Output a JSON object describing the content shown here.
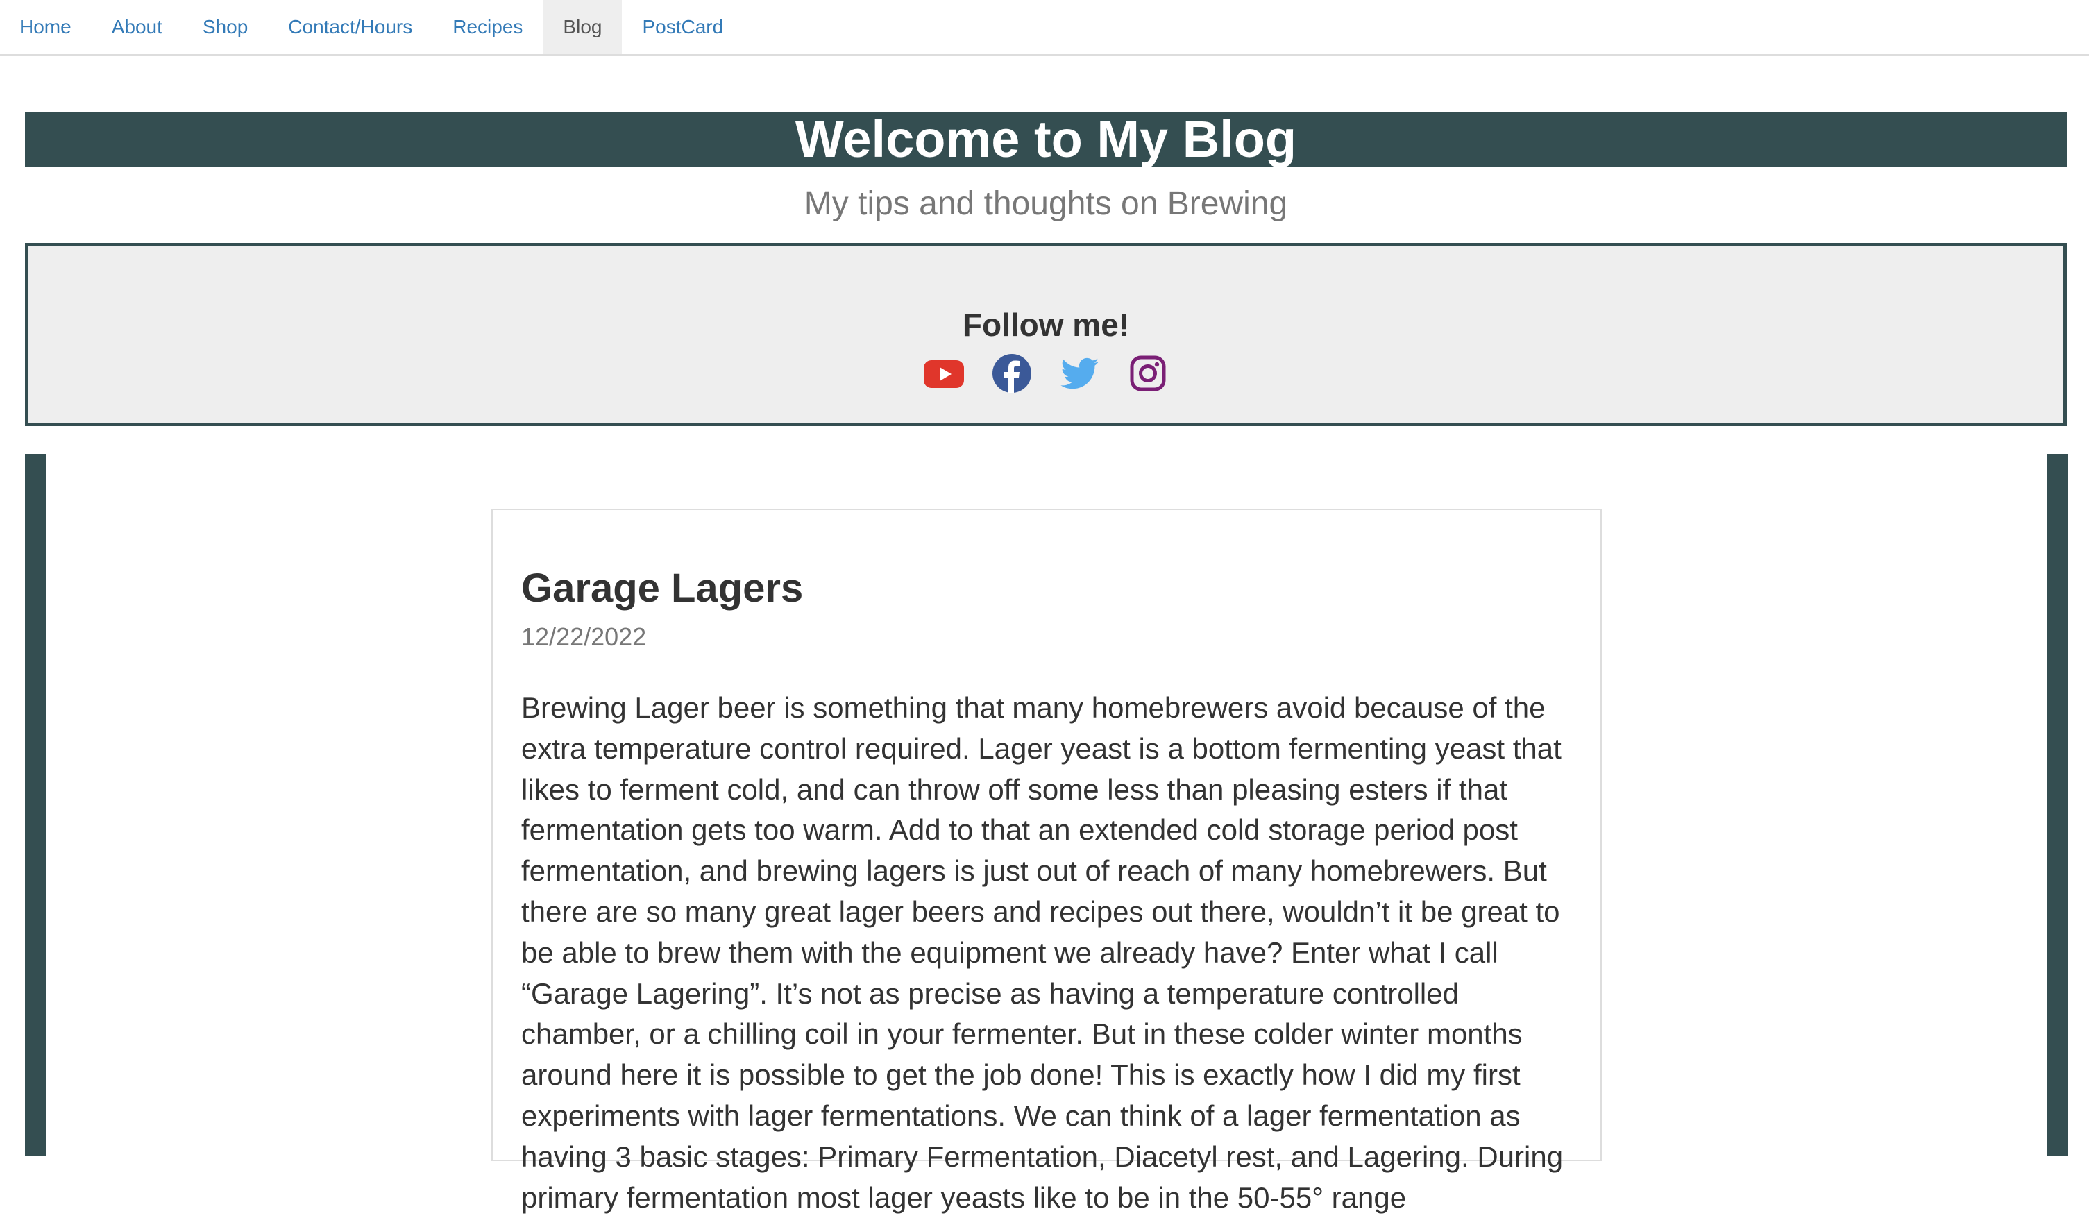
{
  "nav": {
    "items": [
      {
        "label": "Home",
        "active": false
      },
      {
        "label": "About",
        "active": false
      },
      {
        "label": "Shop",
        "active": false
      },
      {
        "label": "Contact/Hours",
        "active": false
      },
      {
        "label": "Recipes",
        "active": false
      },
      {
        "label": "Blog",
        "active": true
      },
      {
        "label": "PostCard",
        "active": false
      }
    ]
  },
  "header": {
    "title": "Welcome to My Blog",
    "subtitle": "My tips and thoughts on Brewing"
  },
  "follow": {
    "title": "Follow me!",
    "icons": [
      {
        "name": "youtube-icon",
        "color": "#e0362b"
      },
      {
        "name": "facebook-icon",
        "color": "#3b5998"
      },
      {
        "name": "twitter-icon",
        "color": "#55acee"
      },
      {
        "name": "instagram-icon",
        "color": "#7a1f75"
      }
    ]
  },
  "post": {
    "title": "Garage Lagers",
    "date": "12/22/2022",
    "body": "Brewing Lager beer is something that many homebrewers avoid because of the extra temperature control required. Lager yeast is a bottom fermenting yeast that likes to ferment cold, and can throw off some less than pleasing esters if that fermentation gets too warm. Add to that an extended cold storage period post fermentation, and brewing lagers is just out of reach of many homebrewers. But there are so many great lager beers and recipes out there, wouldn’t it be great to be able to brew them with the equipment we already have? Enter what I call “Garage Lagering”. It’s not as precise as having a temperature controlled chamber, or a chilling coil in your fermenter. But in these colder winter months around here it is possible to get the job done! This is exactly how I did my first experiments with lager fermentations. We can think of a lager fermentation as having 3 basic stages: Primary Fermentation, Diacetyl rest, and Lagering. During primary fermentation most lager yeasts like to be in the 50-55° range"
  },
  "theme": {
    "accent": "#344e51",
    "link": "#337ab7",
    "panel_bg": "#eeeeee"
  }
}
